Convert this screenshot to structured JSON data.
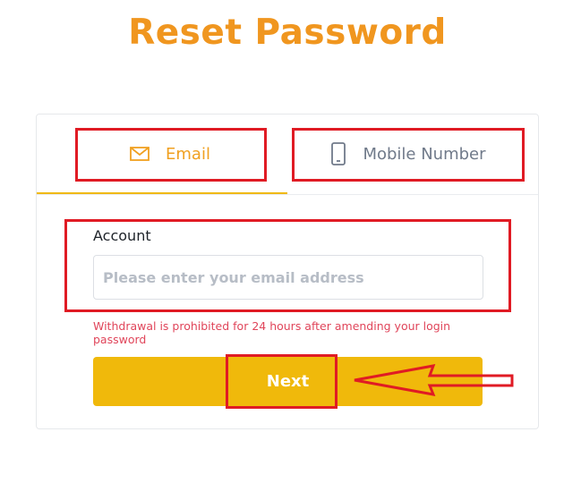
{
  "page": {
    "title": "Reset Password"
  },
  "tabs": [
    {
      "label": "Email",
      "icon": "envelope-icon",
      "active": true
    },
    {
      "label": "Mobile Number",
      "icon": "mobile-phone-icon",
      "active": false
    }
  ],
  "form": {
    "account_label": "Account",
    "email_placeholder": "Please enter your email address",
    "email_value": "",
    "warning": "Withdrawal is prohibited for 24 hours after amending your login password",
    "next_label": "Next"
  },
  "colors": {
    "title": "#f0961f",
    "accent": "#f0b90b",
    "warning": "#e0455a",
    "annotation": "#e01b24"
  }
}
